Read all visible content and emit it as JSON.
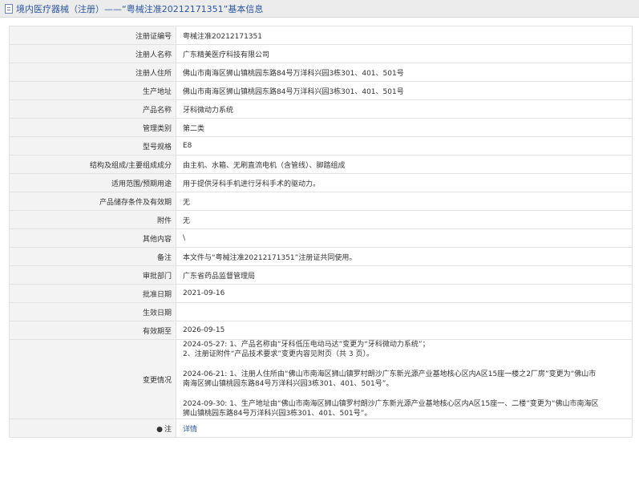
{
  "title": "境内医疗器械（注册）——“粤械注准20212171351”基本信息",
  "rows": [
    {
      "label": "注册证编号",
      "value": "粤械注准20212171351"
    },
    {
      "label": "注册人名称",
      "value": "广东精美医疗科技有限公司"
    },
    {
      "label": "注册人住所",
      "value": "佛山市南海区狮山镇桃园东路84号万洋科兴园3栋301、401、501号"
    },
    {
      "label": "生产地址",
      "value": "佛山市南海区狮山镇桃园东路84号万洋科兴园3栋301、401、501号"
    },
    {
      "label": "产品名称",
      "value": "牙科微动力系统"
    },
    {
      "label": "管理类别",
      "value": "第二类"
    },
    {
      "label": "型号规格",
      "value": "E8"
    },
    {
      "label": "结构及组成/主要组成成分",
      "value": "由主机、水箱、无刷直流电机（含管线）、脚踏组成"
    },
    {
      "label": "适用范围/预期用途",
      "value": "用于提供牙科手机进行牙科手术的驱动力。"
    },
    {
      "label": "产品储存条件及有效期",
      "value": "无"
    },
    {
      "label": "附件",
      "value": "无"
    },
    {
      "label": "其他内容",
      "value": "\\"
    },
    {
      "label": "备注",
      "value": "本文件与“粤械注准20212171351”注册证共同使用。"
    },
    {
      "label": "审批部门",
      "value": "广东省药品监督管理局"
    },
    {
      "label": "批准日期",
      "value": "2021-09-16"
    },
    {
      "label": "生效日期",
      "value": ""
    },
    {
      "label": "有效期至",
      "value": "2026-09-15"
    }
  ],
  "changes": {
    "label": "变更情况",
    "entries": [
      [
        "2024-05-27: 1、产品名称由“牙科低压电动马达”变更为“牙科微动力系统”；",
        "2、注册证附件“产品技术要求”变更内容见附页（共 3 页）。"
      ],
      [
        "2024-06-21: 1、注册人住所由“佛山市南海区狮山镇罗村朗沙广东新光源产业基地核心区内A区15座一楼之2厂房”变更为“佛山市",
        "南海区狮山镇桃园东路84号万洋科兴园3栋301、401、501号”。"
      ],
      [
        "2024-09-30: 1、生产地址由“佛山市南海区狮山镇罗村朗沙广东新光源产业基地核心区内A区15座一、二楼”变更为“佛山市南海区",
        "狮山镇桃园东路84号万洋科兴园3栋301、401、501号”。"
      ]
    ]
  },
  "note": {
    "label": "注",
    "icon": "bulb-icon",
    "icon_glyph": "●",
    "link_text": "详情"
  }
}
